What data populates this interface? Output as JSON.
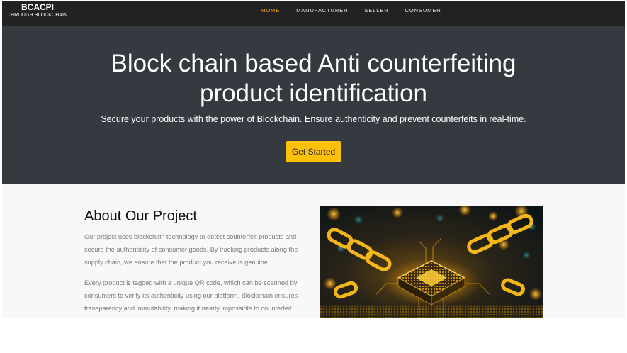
{
  "brand": {
    "title": "BCACPI",
    "subtitle": "THROUGH BLOCKCHAIN"
  },
  "nav": {
    "items": [
      {
        "label": "HOME",
        "active": true
      },
      {
        "label": "MANUFACTURER",
        "active": false
      },
      {
        "label": "SELLER",
        "active": false
      },
      {
        "label": "CONSUMER",
        "active": false
      }
    ]
  },
  "hero": {
    "title_line1": "Block chain based Anti counterfeiting",
    "title_line2": "product identification",
    "subtitle": "Secure your products with the power of Blockchain. Ensure authenticity and prevent counterfeits in real-time.",
    "cta_label": "Get Started"
  },
  "about": {
    "title": "About Our Project",
    "paragraphs": [
      "Our project uses blockchain technology to detect counterfeit products and secure the authenticity of consumer goods. By tracking products along the supply chain, we ensure that the product you receive is genuine.",
      "Every product is tagged with a unique QR code, which can be scanned by consumers to verify its authenticity using our platform. Blockchain ensures transparency and immutability, making it nearly impossible to counterfeit"
    ]
  },
  "colors": {
    "navbar": "#222222",
    "hero": "#343a40",
    "accent": "#ffc107",
    "active_nav": "#f0ad1d"
  }
}
